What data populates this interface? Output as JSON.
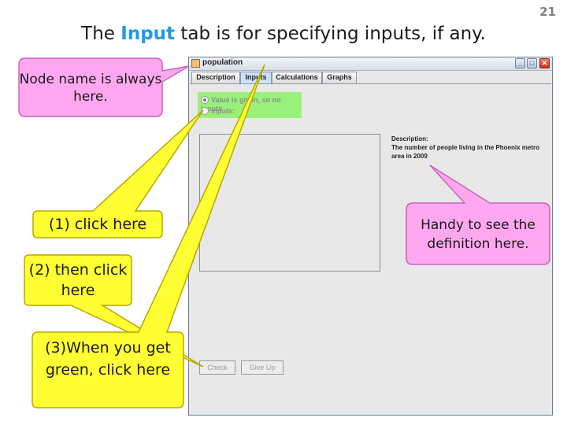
{
  "slide": {
    "number": "21",
    "title_prefix": "The ",
    "title_highlight": "Input",
    "title_suffix": " tab is for specifying inputs, if any."
  },
  "window": {
    "title": "population",
    "icon": "app-icon",
    "controls": {
      "minimize": "_",
      "maximize": "□",
      "close": "✕"
    },
    "tabs": [
      {
        "label": "Description",
        "active": false
      },
      {
        "label": "Inputs",
        "active": true
      },
      {
        "label": "Calculations",
        "active": false
      },
      {
        "label": "Graphs",
        "active": false
      }
    ],
    "radios": [
      {
        "label": "Value is given, so no inputs",
        "checked": true
      },
      {
        "label": "Inputs:",
        "checked": false
      }
    ],
    "radio_highlight_color": "#99f07a",
    "description": {
      "heading": "Description:",
      "text": "The number of people living in the Phoenix metro area in 2009"
    },
    "buttons": {
      "check": "Check",
      "give_up": "Give Up"
    }
  },
  "callouts": {
    "node_name": "Node name is always here.",
    "click_here": "(1) click here",
    "then_click": "(2) then click here",
    "when_green": "(3)When you get green, click here",
    "handy": "Handy to see the definition here."
  },
  "colors": {
    "pink_callout": "#ffa8f0",
    "yellow_callout": "#ffff33",
    "accent_blue": "#1f9ae6"
  }
}
